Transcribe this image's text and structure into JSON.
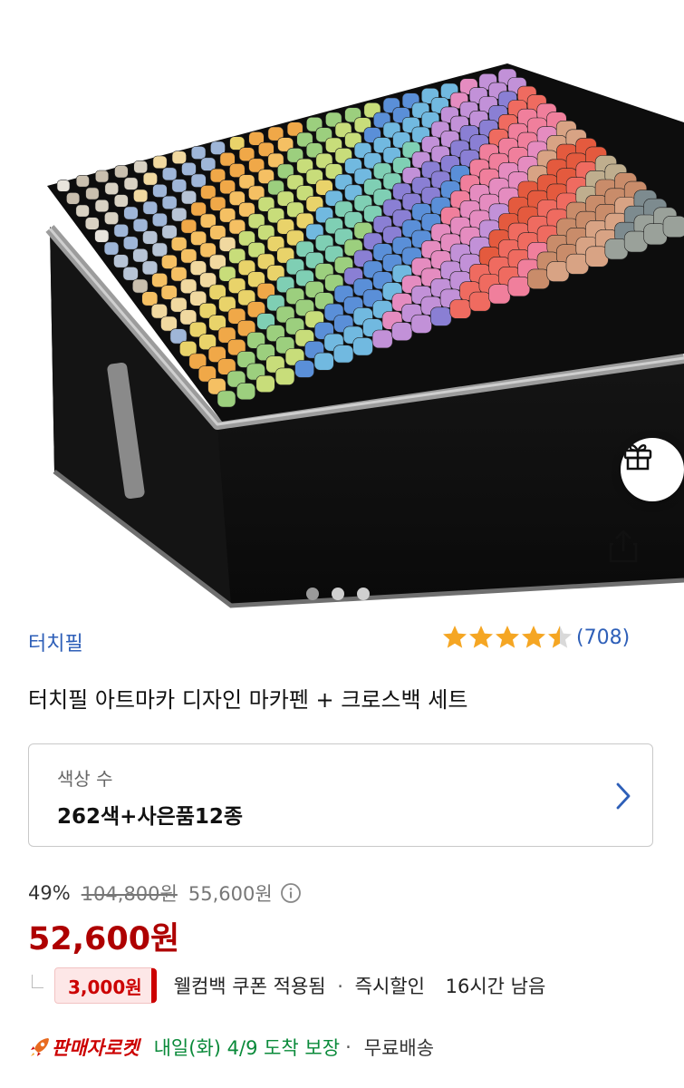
{
  "product": {
    "brand": "터치필",
    "review_count": "(708)",
    "rating": 4.5,
    "title": "터치필 아트마카 디자인 마카펜 + 크로스백 세트"
  },
  "gallery": {
    "total_images": 3,
    "active_index": 0
  },
  "option": {
    "label": "색상 수",
    "value": "262색+사은품12종"
  },
  "price": {
    "discount_rate": "49%",
    "original": "104,800원",
    "base": "55,600원",
    "final": "52,600원"
  },
  "coupon": {
    "amount": "3,000원",
    "text": "웰컴백 쿠폰 적용됨",
    "separator": "·",
    "instant": "즉시할인",
    "time_left": "16시간 남음"
  },
  "delivery": {
    "rocket_label": "판매자로켓",
    "arrival": "내일(화) 4/9 도착 보장",
    "separator": "·",
    "shipping": "무료배송"
  },
  "colors": {
    "brand_blue": "#2e5fb8",
    "price_red": "#ae0000",
    "rocket_red": "#cc0000",
    "arrival_green": "#0a8a3a",
    "star_gold": "#f5a623"
  },
  "icons": {
    "gift": "gift-icon",
    "share": "share-icon",
    "info": "info-icon",
    "chevron": "chevron-right-icon",
    "rocket": "rocket-icon",
    "star": "star-icon"
  }
}
